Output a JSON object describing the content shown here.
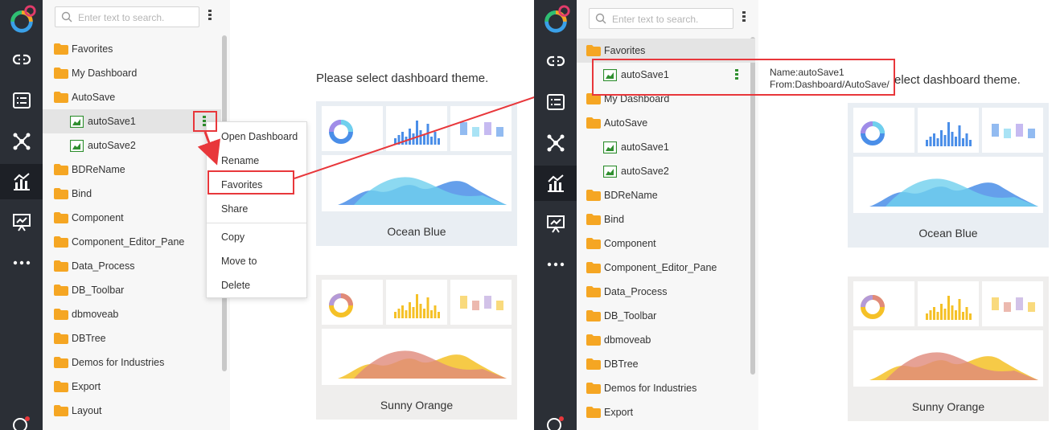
{
  "search": {
    "placeholder": "Enter text to search."
  },
  "left_tree": [
    {
      "label": "Favorites",
      "type": "folder"
    },
    {
      "label": "My Dashboard",
      "type": "folder"
    },
    {
      "label": "AutoSave",
      "type": "folder"
    },
    {
      "label": "autoSave1",
      "type": "dashboard",
      "selected": true
    },
    {
      "label": "autoSave2",
      "type": "dashboard"
    },
    {
      "label": "BDReName",
      "type": "folder"
    },
    {
      "label": "Bind",
      "type": "folder"
    },
    {
      "label": "Component",
      "type": "folder"
    },
    {
      "label": "Component_Editor_Pane",
      "type": "folder"
    },
    {
      "label": "Data_Process",
      "type": "folder"
    },
    {
      "label": "DB_Toolbar",
      "type": "folder"
    },
    {
      "label": "dbmoveab",
      "type": "folder"
    },
    {
      "label": "DBTree",
      "type": "folder"
    },
    {
      "label": "Demos for Industries",
      "type": "folder"
    },
    {
      "label": "Export",
      "type": "folder"
    },
    {
      "label": "Layout",
      "type": "folder"
    }
  ],
  "context_menu": [
    "Open Dashboard",
    "Rename",
    "Favorites",
    "Share",
    "Copy",
    "Move to",
    "Delete"
  ],
  "right_tree": [
    {
      "label": "Favorites",
      "type": "folder",
      "selected": true
    },
    {
      "label": "autoSave1",
      "type": "dashboard",
      "boxed": true
    },
    {
      "label": "My Dashboard",
      "type": "folder"
    },
    {
      "label": "AutoSave",
      "type": "folder"
    },
    {
      "label": "autoSave1",
      "type": "dashboard"
    },
    {
      "label": "autoSave2",
      "type": "dashboard"
    },
    {
      "label": "BDReName",
      "type": "folder"
    },
    {
      "label": "Bind",
      "type": "folder"
    },
    {
      "label": "Component",
      "type": "folder"
    },
    {
      "label": "Component_Editor_Pane",
      "type": "folder"
    },
    {
      "label": "Data_Process",
      "type": "folder"
    },
    {
      "label": "DB_Toolbar",
      "type": "folder"
    },
    {
      "label": "dbmoveab",
      "type": "folder"
    },
    {
      "label": "DBTree",
      "type": "folder"
    },
    {
      "label": "Demos for Industries",
      "type": "folder"
    },
    {
      "label": "Export",
      "type": "folder"
    }
  ],
  "tooltip": {
    "name": "Name:autoSave1",
    "from": "From:Dashboard/AutoSave/"
  },
  "prompt_left": "Please select dashboard theme.",
  "prompt_right": "elect dashboard theme.",
  "themes": [
    {
      "name": "Ocean Blue",
      "colors": [
        "#4a8ee8",
        "#6fd0ee",
        "#a08ce8"
      ]
    },
    {
      "name": "Sunny Orange",
      "colors": [
        "#f5c127",
        "#e08a7a",
        "#b49ad8"
      ]
    }
  ],
  "colors": {
    "rail": "#2b2f36",
    "highlight": "#e8373b",
    "folder": "#f5a623",
    "dashboard_icon": "#2f8f2f"
  },
  "rail_icons": [
    "link-icon",
    "list-icon",
    "network-icon",
    "chart-icon",
    "presentation-icon",
    "more-icon"
  ]
}
